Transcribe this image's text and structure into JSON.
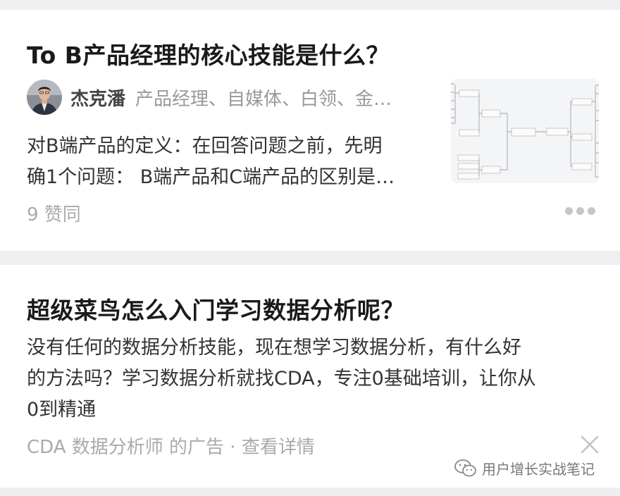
{
  "feed": {
    "answer_card": {
      "title": "To B产品经理的核心技能是什么？",
      "author": {
        "name": "杰克潘",
        "tags": "产品经理、自媒体、白领、金…"
      },
      "excerpt_line1": "对B端产品的定义：在回答问题之前，先明",
      "excerpt_line2": "确1个问题： B端产品和C端产品的区别是…",
      "likes": "9 赞同",
      "thumbnail_icon": "mindmap-thumbnail",
      "more_icon": "more-dots-icon"
    },
    "ad_card": {
      "title": "超级菜鸟怎么入门学习数据分析呢？",
      "body_line1": "没有任何的数据分析技能，现在想学习数据分析，有什么好",
      "body_line2": "的方法吗？学习数据分析就找CDA，专注0基础培训，让你从",
      "body_line3": "0到精通",
      "source": "CDA 数据分析师 的广告 · 查看详情",
      "close_icon": "close-icon"
    }
  },
  "watermark": {
    "text": "用户增长实战笔记",
    "icon": "wechat-icon"
  },
  "colors": {
    "background": "#efeff1",
    "card": "#ffffff",
    "title": "#1a1a1a",
    "muted": "#aaaaaa"
  }
}
